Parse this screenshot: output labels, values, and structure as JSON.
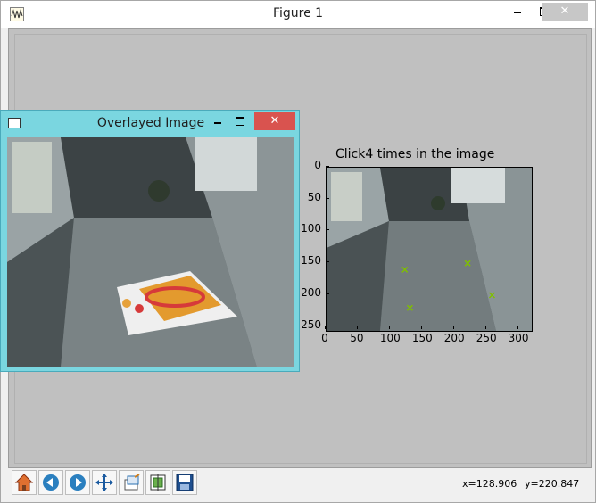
{
  "main_window": {
    "title": "Figure 1",
    "minimize_label": "",
    "maximize_label": "",
    "close_label": "✕"
  },
  "overlay_window": {
    "title": "Overlayed Image",
    "close_label": "✕"
  },
  "chart_data": {
    "type": "scatter",
    "title": "Click4 times in the  image",
    "xlabel": "",
    "ylabel": "",
    "xlim": [
      0,
      320
    ],
    "ylim": [
      256,
      0
    ],
    "x_ticks": [
      0,
      50,
      100,
      150,
      200,
      250,
      300
    ],
    "y_ticks": [
      0,
      50,
      100,
      150,
      200,
      250
    ],
    "grid": false,
    "marker": "x",
    "marker_color": "#7fbf00",
    "series": [
      {
        "values": [
          [
            122,
            160
          ],
          [
            220,
            150
          ],
          [
            130,
            220
          ],
          [
            258,
            200
          ]
        ]
      }
    ]
  },
  "toolbar": {
    "icons": [
      "home-icon",
      "back-icon",
      "forward-icon",
      "pan-icon",
      "zoom-icon",
      "subplots-icon",
      "save-icon"
    ]
  },
  "status": {
    "x_readout": "x=128.906",
    "y_readout": "y=220.847"
  },
  "colors": {
    "overlay_frame": "#7ad6e0",
    "close_red": "#d9534f",
    "canvas_gray": "#c0c0c0"
  }
}
